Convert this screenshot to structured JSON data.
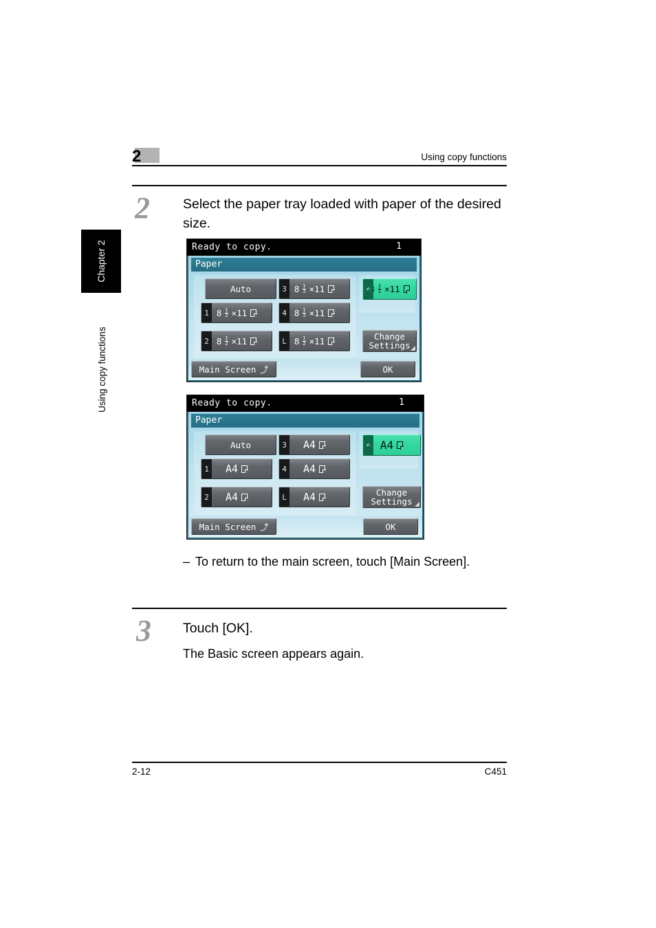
{
  "header": {
    "chapter_number": "2",
    "running_title": "Using copy functions"
  },
  "sidebar": {
    "tab_label": "Chapter 2",
    "running_head": "Using copy functions"
  },
  "steps": [
    {
      "number": "2",
      "text": "Select the paper tray loaded with paper of the desired size."
    },
    {
      "number": "3",
      "text": "Touch [OK]."
    }
  ],
  "sub_note": {
    "dash": "–",
    "text": "To return to the main screen, touch [Main Screen]."
  },
  "body_text": "The Basic screen appears again.",
  "footer": {
    "page_number": "2-12",
    "model": "C451"
  },
  "screens": [
    {
      "id": "screen-inch",
      "status_text": "Ready to copy.",
      "copy_count": "1",
      "section_label": "Paper",
      "auto_label": "Auto",
      "paper_size_whole": "8",
      "paper_size_num": "1",
      "paper_size_den": "2",
      "paper_size_rest": "×11",
      "trays": [
        {
          "chip": "1",
          "size": "8½×11"
        },
        {
          "chip": "2",
          "size": "8½×11"
        },
        {
          "chip": "3",
          "size": "8½×11"
        },
        {
          "chip": "4",
          "size": "8½×11"
        },
        {
          "chip": "L",
          "size": "8½×11"
        }
      ],
      "bypass": {
        "chip_icon": "hand-icon",
        "size": "8½×11",
        "selected": true
      },
      "change_settings_line1": "Change",
      "change_settings_line2": "Settings",
      "main_screen_label": "Main Screen",
      "main_screen_arrow": "⤴",
      "ok_label": "OK"
    },
    {
      "id": "screen-metric",
      "status_text": "Ready to copy.",
      "copy_count": "1",
      "section_label": "Paper",
      "auto_label": "Auto",
      "paper_size_plain": "A4",
      "trays": [
        {
          "chip": "1",
          "size": "A4"
        },
        {
          "chip": "2",
          "size": "A4"
        },
        {
          "chip": "3",
          "size": "A4"
        },
        {
          "chip": "4",
          "size": "A4"
        },
        {
          "chip": "L",
          "size": "A4"
        }
      ],
      "bypass": {
        "chip_icon": "hand-icon",
        "size": "A4",
        "selected": true
      },
      "change_settings_line1": "Change",
      "change_settings_line2": "Settings",
      "main_screen_label": "Main Screen",
      "main_screen_arrow": "⤴",
      "ok_label": "OK"
    }
  ],
  "colors": {
    "lcd_title_bg": "#000000",
    "section_bar": "#2d7f95",
    "lcd_body": "#bfe2ef",
    "selected_green": "#35d79f",
    "button_grey": "#62656a",
    "badge_grey": "#b3b3b3",
    "step_number_grey": "#9a9a9a"
  }
}
